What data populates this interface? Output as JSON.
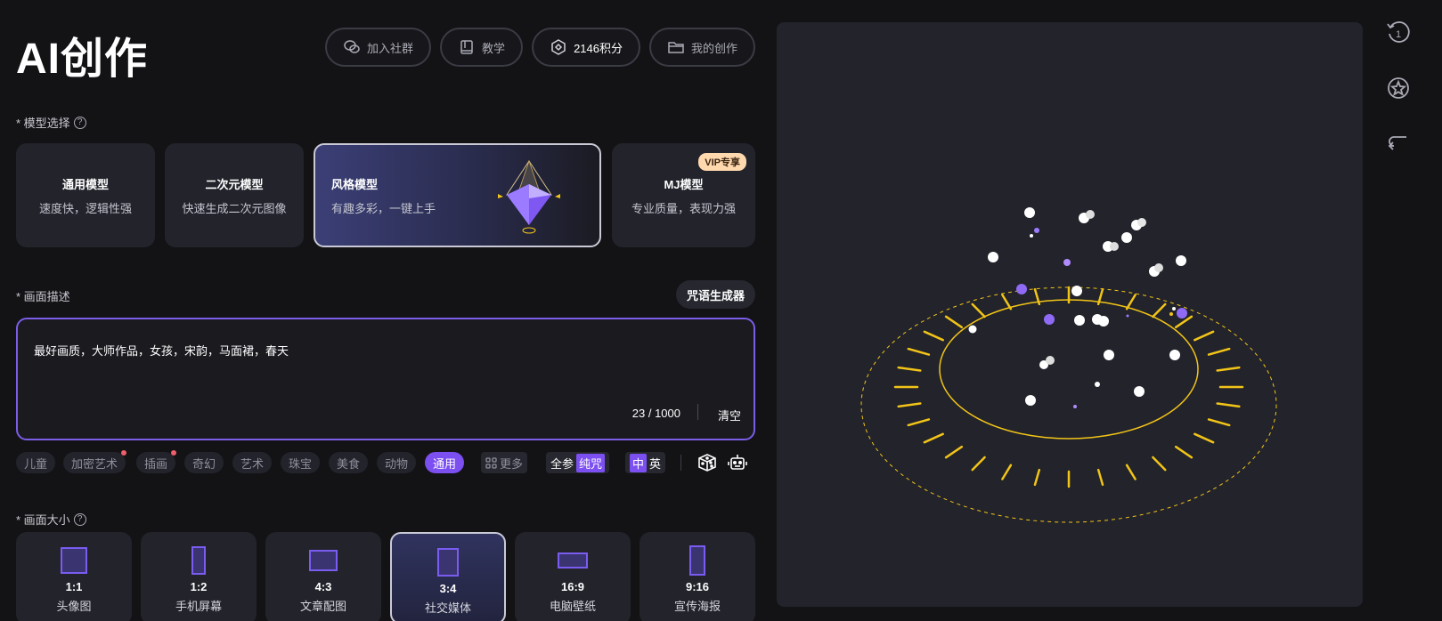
{
  "page": {
    "title": "AI创作"
  },
  "header_buttons": {
    "join_group": "加入社群",
    "tutorial": "教学",
    "points": "2146积分",
    "my_creations": "我的创作"
  },
  "model_section": {
    "label": "* 模型选择",
    "models": [
      {
        "title": "通用模型",
        "desc": "速度快，逻辑性强"
      },
      {
        "title": "二次元模型",
        "desc": "快速生成二次元图像"
      },
      {
        "title": "风格模型",
        "desc": "有趣多彩，一键上手"
      },
      {
        "title": "MJ模型",
        "desc": "专业质量，表现力强",
        "badge": "VIP专享"
      }
    ],
    "selected": "风格模型"
  },
  "prompt_section": {
    "label": "* 画面描述",
    "generator_button": "咒语生成器",
    "text": "最好画质，大师作品，女孩，宋韵，马面裙，春天",
    "counter": "23 / 1000",
    "clear": "清空"
  },
  "tags": {
    "items": [
      {
        "label": "儿童",
        "dot": false
      },
      {
        "label": "加密艺术",
        "dot": true
      },
      {
        "label": "插画",
        "dot": true
      },
      {
        "label": "奇幻",
        "dot": false
      },
      {
        "label": "艺术",
        "dot": false
      },
      {
        "label": "珠宝",
        "dot": false
      },
      {
        "label": "美食",
        "dot": false
      },
      {
        "label": "动物",
        "dot": false
      },
      {
        "label": "通用",
        "dot": false
      }
    ],
    "active": "通用",
    "more": "更多",
    "mode_full": "全参",
    "mode_pure": "纯咒",
    "lang_cn": "中",
    "lang_en": "英"
  },
  "size_section": {
    "label": "* 画面大小",
    "sizes": [
      {
        "ratio": "1:1",
        "name": "头像图"
      },
      {
        "ratio": "1:2",
        "name": "手机屏幕"
      },
      {
        "ratio": "4:3",
        "name": "文章配图"
      },
      {
        "ratio": "3:4",
        "name": "社交媒体"
      },
      {
        "ratio": "16:9",
        "name": "电脑壁纸"
      },
      {
        "ratio": "9:16",
        "name": "宣传海报"
      }
    ],
    "selected": "3:4"
  },
  "side_toolbar": {
    "history_badge": "1"
  },
  "colors": {
    "accent": "#7c4ff0",
    "background": "#131316",
    "card": "#22232b",
    "gold": "#f2c418",
    "vip_badge": "#ffd8ae",
    "tag_dot": "#ef5e6b"
  }
}
